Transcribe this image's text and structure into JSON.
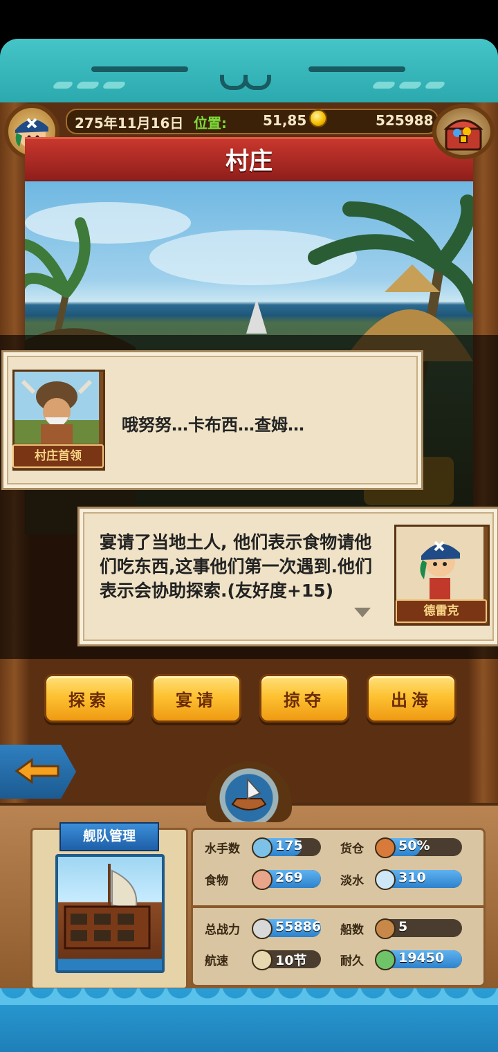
{
  "header": {
    "date": "275年11月16日",
    "position_label": "位置:",
    "position_value": "51,85",
    "gold": "525988",
    "location_title": "村庄"
  },
  "dialog_npc": {
    "name": "村庄首领",
    "text": "哦努努…卡布西…查姆…"
  },
  "dialog_player": {
    "name": "德雷克",
    "text": "宴请了当地土人, 他们表示食物请他们吃东西,这事他们第一次遇到.他们表示会协助探索.(友好度+15)"
  },
  "actions": [
    {
      "label": "探索"
    },
    {
      "label": "宴请"
    },
    {
      "label": "掠夺"
    },
    {
      "label": "出海"
    }
  ],
  "fleet": {
    "title": "舰队管理",
    "stats": [
      {
        "label": "水手数",
        "value": "175",
        "icon": "sailor-icon",
        "fill": 0.7
      },
      {
        "label": "货仓",
        "value": "50%",
        "icon": "cargo-icon",
        "fill": 0.5
      },
      {
        "label": "食物",
        "value": "269",
        "icon": "meat-icon",
        "fill": 1.0
      },
      {
        "label": "淡水",
        "value": "310",
        "icon": "water-jug-icon",
        "fill": 1.0
      },
      {
        "label": "总战力",
        "value": "55886",
        "icon": "crossed-swords-icon",
        "fill": 1.0
      },
      {
        "label": "船数",
        "value": "5",
        "icon": "boat-icon",
        "fill": 0.0
      },
      {
        "label": "航速",
        "value": "10节",
        "icon": "sail-ship-icon",
        "fill": 0.0
      },
      {
        "label": "耐久",
        "value": "19450",
        "icon": "durability-icon",
        "fill": 1.0
      }
    ]
  },
  "colors": {
    "wood_dark": "#5b2f12",
    "ribbon_red": "#b02a24",
    "button_gold": "#fdc232",
    "stat_blue": "#2d82cc",
    "teal": "#2aa8ad"
  }
}
